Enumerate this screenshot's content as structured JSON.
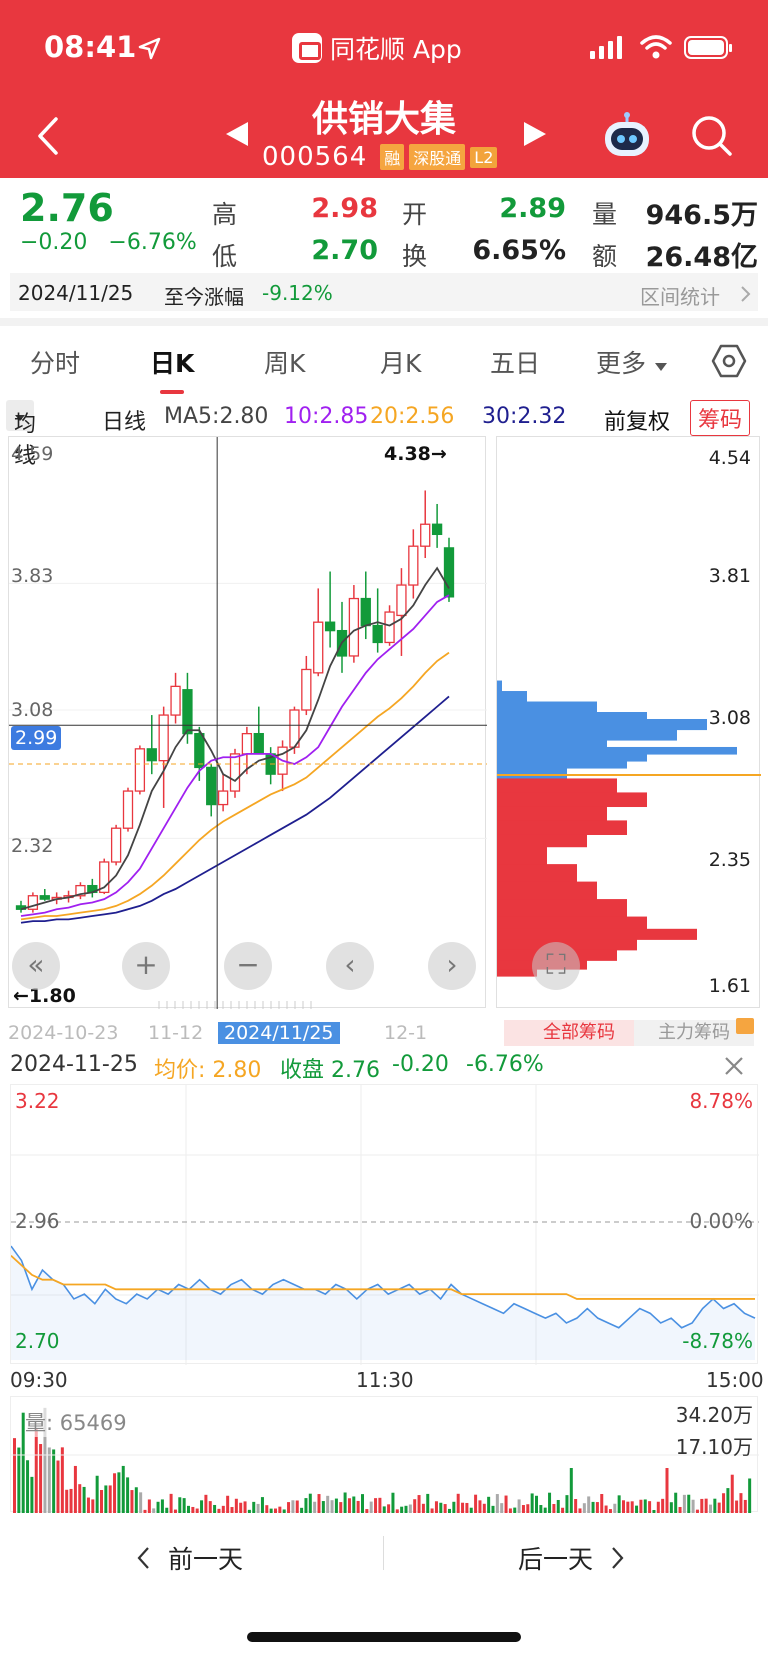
{
  "status": {
    "time": "08:41",
    "app_name": "同花顺 App"
  },
  "stock": {
    "name": "供销大集",
    "code": "000564",
    "tags": [
      "融",
      "深股通",
      "L2"
    ]
  },
  "quote": {
    "price": "2.76",
    "change": "−0.20",
    "change_pct": "−6.76%",
    "high_label": "高",
    "high": "2.98",
    "low_label": "低",
    "low": "2.70",
    "open_label": "开",
    "open": "2.89",
    "turnover_label": "换",
    "turnover": "6.65%",
    "volume_label": "量",
    "volume": "946.5万",
    "amount_label": "额",
    "amount": "26.48亿",
    "colors": {
      "up": "#e8373f",
      "down": "#129a3a"
    }
  },
  "date_bar": {
    "date": "2024/11/25",
    "since_label": "至今涨幅",
    "since_value": "-9.12%",
    "stats_label": "区间统计"
  },
  "tabs": [
    "分时",
    "日K",
    "周K",
    "月K",
    "五日",
    "更多"
  ],
  "ma": {
    "selector": "均线",
    "period": "日线",
    "ma5": "MA5:2.80",
    "ma10": "10:2.85",
    "ma20": "20:2.56",
    "ma30": "30:2.32",
    "adjust": "前复权",
    "chips_button": "筹码",
    "colors": {
      "ma5": "#444444",
      "ma10": "#a020f0",
      "ma20": "#f5a623",
      "ma30": "#1f1f8f"
    }
  },
  "kchart": {
    "y_labels": [
      "4.59",
      "3.83",
      "3.08",
      "2.32"
    ],
    "crosshair_price": "2.99",
    "high_marker": "4.38→",
    "low_marker": "←1.80",
    "x_labels": [
      "2024-10-23",
      "11-12",
      "2024/11/25",
      "12-1"
    ],
    "candles": [
      [
        1.92,
        1.95,
        1.88,
        1.9
      ],
      [
        1.9,
        2.0,
        1.88,
        1.98
      ],
      [
        1.98,
        2.02,
        1.95,
        1.96
      ],
      [
        1.96,
        2.0,
        1.93,
        1.97
      ],
      [
        1.97,
        2.01,
        1.94,
        1.98
      ],
      [
        1.98,
        2.06,
        1.96,
        2.04
      ],
      [
        2.04,
        2.08,
        1.97,
        2.0
      ],
      [
        2.0,
        2.2,
        1.99,
        2.18
      ],
      [
        2.18,
        2.4,
        2.16,
        2.38
      ],
      [
        2.38,
        2.62,
        2.36,
        2.6
      ],
      [
        2.6,
        2.87,
        2.58,
        2.85
      ],
      [
        2.85,
        3.05,
        2.7,
        2.78
      ],
      [
        2.78,
        3.1,
        2.5,
        3.05
      ],
      [
        3.05,
        3.3,
        3.0,
        3.22
      ],
      [
        3.2,
        3.3,
        2.88,
        2.94
      ],
      [
        2.94,
        2.98,
        2.66,
        2.74
      ],
      [
        2.74,
        2.76,
        2.45,
        2.52
      ],
      [
        2.52,
        2.7,
        2.48,
        2.6
      ],
      [
        2.6,
        2.85,
        2.56,
        2.82
      ],
      [
        2.82,
        2.98,
        2.7,
        2.94
      ],
      [
        2.94,
        3.1,
        2.9,
        2.82
      ],
      [
        2.82,
        2.86,
        2.64,
        2.7
      ],
      [
        2.7,
        2.9,
        2.6,
        2.86
      ],
      [
        2.86,
        3.1,
        2.82,
        3.08
      ],
      [
        3.08,
        3.4,
        3.05,
        3.32
      ],
      [
        3.3,
        3.8,
        3.28,
        3.6
      ],
      [
        3.6,
        3.9,
        3.45,
        3.55
      ],
      [
        3.55,
        3.72,
        3.3,
        3.4
      ],
      [
        3.4,
        3.82,
        3.36,
        3.74
      ],
      [
        3.74,
        3.9,
        3.5,
        3.58
      ],
      [
        3.58,
        3.8,
        3.42,
        3.48
      ],
      [
        3.48,
        3.7,
        3.46,
        3.66
      ],
      [
        3.64,
        3.92,
        3.4,
        3.82
      ],
      [
        3.82,
        4.15,
        3.74,
        4.05
      ],
      [
        4.05,
        4.38,
        3.98,
        4.18
      ],
      [
        4.18,
        4.3,
        4.04,
        4.12
      ],
      [
        4.04,
        4.1,
        3.72,
        3.75
      ]
    ],
    "ma_lines": {
      "ma5": [
        1.9,
        1.92,
        1.94,
        1.96,
        1.97,
        1.99,
        2.0,
        2.03,
        2.1,
        2.22,
        2.4,
        2.6,
        2.72,
        2.86,
        2.96,
        2.96,
        2.84,
        2.7,
        2.66,
        2.73,
        2.78,
        2.8,
        2.82,
        2.86,
        2.96,
        3.14,
        3.34,
        3.48,
        3.55,
        3.58,
        3.6,
        3.58,
        3.62,
        3.7,
        3.82,
        3.92,
        3.8
      ],
      "ma10": [
        1.86,
        1.87,
        1.88,
        1.9,
        1.91,
        1.93,
        1.94,
        1.96,
        2.0,
        2.06,
        2.14,
        2.26,
        2.38,
        2.5,
        2.62,
        2.72,
        2.78,
        2.8,
        2.8,
        2.82,
        2.82,
        2.82,
        2.78,
        2.76,
        2.8,
        2.86,
        2.98,
        3.1,
        3.2,
        3.3,
        3.38,
        3.44,
        3.5,
        3.56,
        3.64,
        3.72,
        3.76
      ],
      "ma20": [
        1.84,
        1.85,
        1.86,
        1.86,
        1.87,
        1.88,
        1.89,
        1.9,
        1.92,
        1.95,
        1.99,
        2.04,
        2.1,
        2.17,
        2.24,
        2.31,
        2.37,
        2.42,
        2.46,
        2.5,
        2.54,
        2.58,
        2.61,
        2.64,
        2.68,
        2.74,
        2.8,
        2.86,
        2.92,
        2.98,
        3.04,
        3.09,
        3.15,
        3.22,
        3.3,
        3.37,
        3.42
      ],
      "ma30": [
        1.82,
        1.83,
        1.83,
        1.84,
        1.84,
        1.85,
        1.86,
        1.87,
        1.88,
        1.9,
        1.92,
        1.95,
        1.99,
        2.02,
        2.06,
        2.1,
        2.14,
        2.18,
        2.22,
        2.26,
        2.3,
        2.34,
        2.38,
        2.42,
        2.46,
        2.51,
        2.56,
        2.62,
        2.68,
        2.74,
        2.8,
        2.86,
        2.92,
        2.98,
        3.04,
        3.1,
        3.16
      ]
    },
    "ylim": [
      1.57,
      4.59
    ]
  },
  "chips": {
    "y_labels": [
      "4.54",
      "3.81",
      "3.08",
      "2.35",
      "1.61"
    ],
    "buttons": [
      "全部筹码",
      "主力筹码"
    ],
    "above_color": "#4a90e2",
    "below_color": "#e8373f",
    "profile": [
      [
        4.54,
        0
      ],
      [
        4.4,
        0
      ],
      [
        4.2,
        0
      ],
      [
        4.0,
        0
      ],
      [
        3.81,
        0
      ],
      [
        3.6,
        0
      ],
      [
        3.4,
        0
      ],
      [
        3.3,
        5
      ],
      [
        3.24,
        30
      ],
      [
        3.18,
        100
      ],
      [
        3.12,
        150
      ],
      [
        3.08,
        210
      ],
      [
        3.02,
        180
      ],
      [
        2.96,
        110
      ],
      [
        2.92,
        240
      ],
      [
        2.88,
        150
      ],
      [
        2.84,
        130
      ],
      [
        2.8,
        70
      ],
      [
        2.74,
        120
      ],
      [
        2.66,
        150
      ],
      [
        2.58,
        110
      ],
      [
        2.5,
        130
      ],
      [
        2.42,
        90
      ],
      [
        2.35,
        50
      ],
      [
        2.25,
        80
      ],
      [
        2.15,
        100
      ],
      [
        2.05,
        130
      ],
      [
        1.95,
        150
      ],
      [
        1.88,
        200
      ],
      [
        1.82,
        140
      ],
      [
        1.76,
        120
      ],
      [
        1.7,
        90
      ],
      [
        1.65,
        40
      ],
      [
        1.61,
        10
      ]
    ],
    "current_price": 2.76
  },
  "detail": {
    "date": "2024-11-25",
    "avg_label": "均价: 2.80",
    "close_label": "收盘 2.76",
    "change": "-0.20",
    "change_pct": "-6.76%"
  },
  "intraday": {
    "price_top": "3.22",
    "price_mid": "2.96",
    "price_bot": "2.70",
    "pct_top": "8.78%",
    "pct_mid": "0.00%",
    "pct_bot": "-8.78%",
    "x_labels": [
      "09:30",
      "11:30",
      "15:00"
    ],
    "ylim": [
      2.7,
      3.22
    ],
    "prices": [
      2.91,
      2.88,
      2.82,
      2.86,
      2.84,
      2.83,
      2.8,
      2.81,
      2.79,
      2.82,
      2.8,
      2.79,
      2.81,
      2.8,
      2.82,
      2.81,
      2.83,
      2.82,
      2.84,
      2.82,
      2.81,
      2.83,
      2.84,
      2.82,
      2.81,
      2.83,
      2.84,
      2.83,
      2.82,
      2.82,
      2.81,
      2.83,
      2.82,
      2.8,
      2.82,
      2.83,
      2.81,
      2.82,
      2.83,
      2.81,
      2.82,
      2.8,
      2.83,
      2.81,
      2.8,
      2.79,
      2.78,
      2.77,
      2.79,
      2.78,
      2.77,
      2.76,
      2.77,
      2.75,
      2.76,
      2.78,
      2.76,
      2.75,
      2.74,
      2.76,
      2.78,
      2.77,
      2.75,
      2.76,
      2.74,
      2.75,
      2.78,
      2.8,
      2.78,
      2.79,
      2.77,
      2.76
    ],
    "avg": [
      2.89,
      2.87,
      2.85,
      2.84,
      2.84,
      2.83,
      2.83,
      2.83,
      2.83,
      2.83,
      2.82,
      2.82,
      2.82,
      2.82,
      2.82,
      2.82,
      2.82,
      2.82,
      2.82,
      2.82,
      2.82,
      2.82,
      2.82,
      2.82,
      2.82,
      2.82,
      2.82,
      2.82,
      2.82,
      2.82,
      2.82,
      2.82,
      2.82,
      2.82,
      2.82,
      2.82,
      2.82,
      2.82,
      2.82,
      2.82,
      2.82,
      2.82,
      2.82,
      2.81,
      2.81,
      2.81,
      2.81,
      2.81,
      2.81,
      2.81,
      2.81,
      2.81,
      2.81,
      2.81,
      2.8,
      2.8,
      2.8,
      2.8,
      2.8,
      2.8,
      2.8,
      2.8,
      2.8,
      2.8,
      2.8,
      2.8,
      2.8,
      2.8,
      2.8,
      2.8,
      2.8,
      2.8
    ]
  },
  "volume": {
    "label": "量: 65469",
    "top": "34.20万",
    "mid": "17.10万"
  },
  "nav": {
    "prev": "前一天",
    "next": "后一天"
  }
}
